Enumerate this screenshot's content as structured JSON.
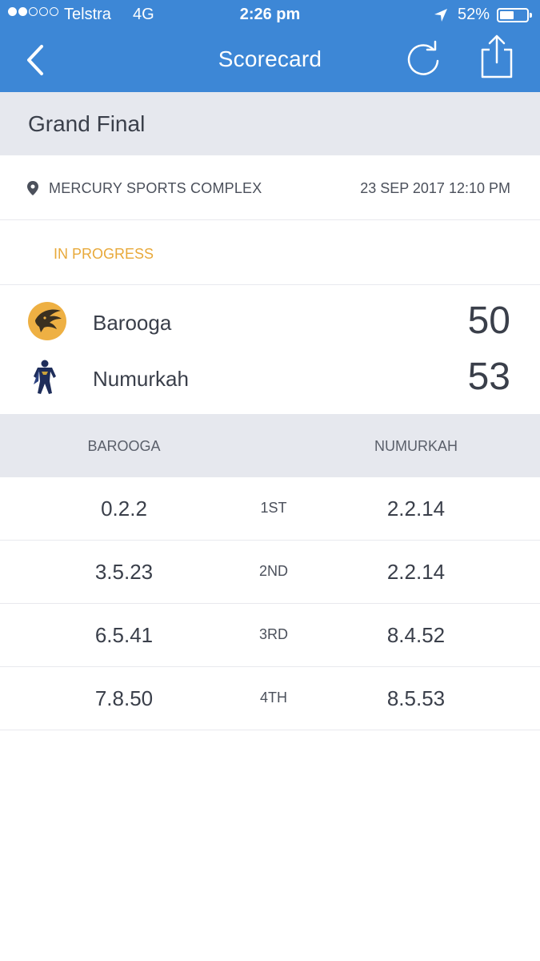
{
  "status_bar": {
    "carrier": "Telstra",
    "network": "4G",
    "time": "2:26 pm",
    "battery": "52%",
    "battery_level": 0.52,
    "signal_bars_filled": 2,
    "signal_bars_total": 5
  },
  "nav": {
    "title": "Scorecard",
    "icons": [
      "chevron-left-icon",
      "refresh-icon",
      "share-icon"
    ]
  },
  "round": {
    "title": "Grand Final"
  },
  "venue": {
    "name": "MERCURY SPORTS COMPLEX",
    "datetime": "23 SEP 2017 12:10 PM"
  },
  "match_status": {
    "label": "IN PROGRESS",
    "color": "#e8a93a"
  },
  "teams": [
    {
      "name": "Barooga",
      "score": "50",
      "logo": "hawk-logo-icon"
    },
    {
      "name": "Numurkah",
      "score": "53",
      "logo": "superhero-logo-icon"
    }
  ],
  "quarters": {
    "home_header": "BAROOGA",
    "away_header": "NUMURKAH",
    "rows": [
      {
        "home": "0.2.2",
        "label": "1ST",
        "away": "2.2.14"
      },
      {
        "home": "3.5.23",
        "label": "2ND",
        "away": "2.2.14"
      },
      {
        "home": "6.5.41",
        "label": "3RD",
        "away": "8.4.52"
      },
      {
        "home": "7.8.50",
        "label": "4TH",
        "away": "8.5.53"
      }
    ]
  },
  "colors": {
    "header_blue": "#3d87d6",
    "section_gray": "#e6e8ee",
    "text_dark": "#3a3f4a",
    "accent_orange": "#e8a93a"
  }
}
